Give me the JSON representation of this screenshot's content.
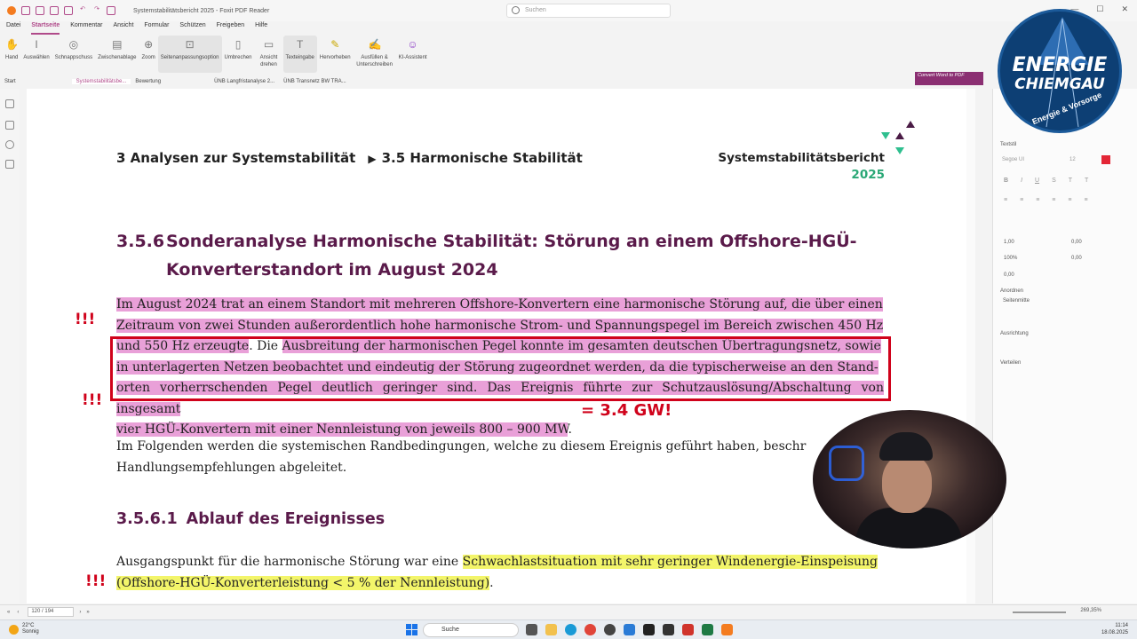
{
  "window": {
    "title": "Systemstabilitätsbericht 2025 - Foxit PDF Reader",
    "search_placeholder": "Suchen"
  },
  "menu": [
    "Datei",
    "Startseite",
    "Kommentar",
    "Ansicht",
    "Formular",
    "Schützen",
    "Freigeben",
    "Hilfe"
  ],
  "ribbon": [
    {
      "label": "Hand",
      "icon": "hand-icon"
    },
    {
      "label": "Auswählen",
      "icon": "select-icon"
    },
    {
      "label": "Schnappschuss",
      "icon": "snapshot-icon"
    },
    {
      "label": "Zwischenablage",
      "icon": "clipboard-icon"
    },
    {
      "label": "Zoom",
      "icon": "zoom-icon"
    },
    {
      "label": "Seitenanpassungsoption",
      "icon": "fit-page-icon"
    },
    {
      "label": "Umbrechen",
      "icon": "reflow-icon"
    },
    {
      "label": "Ansicht drehen",
      "icon": "rotate-icon"
    },
    {
      "label": "Texteingabe",
      "icon": "text-input-icon"
    },
    {
      "label": "Hervorheben",
      "icon": "highlight-icon"
    },
    {
      "label": "Ausfüllen & Unterschreiben",
      "icon": "sign-icon"
    },
    {
      "label": "KI-Assistent",
      "icon": "ai-icon"
    }
  ],
  "tabs": [
    "Start",
    "Systemstabilitätsbe...",
    "Bewertung",
    "ÜNB Langfristanalyse 2...",
    "ÜNB Transnetz BW TRA..."
  ],
  "convert_label": "Convert Word to PDF",
  "document": {
    "header_left_section": "3 Analysen zur Systemstabilität",
    "header_left_subsection": "3.5 Harmonische Stabilität",
    "header_right_title": "Systemstabilitätsbericht",
    "header_right_year": "2025",
    "heading_number": "3.5.6",
    "heading_text": "Sonderanalyse Harmonische Stabilität: Störung an einem Offshore-HGÜ-Konverterstandort im August 2024",
    "p1_line1": "Im August 2024 trat an einem Standort mit mehreren Offshore-Konvertern eine harmonische Störung auf, die über einen",
    "p1_line2": "Zeitraum von zwei Stunden außerordentlich hohe harmonische Strom- und Spannungspegel im Bereich zwischen 450 Hz",
    "p1_line3a": "und 550 Hz erzeugte",
    "p1_line3b": ". Die ",
    "p1_line3c": "Ausbreitung der harmonischen Pegel konnte im gesamten deutschen Übertragungsnetz, sowie",
    "p1_line4": "in unterlagerten Netzen beobachtet und eindeutig der Störung zugeordnet werden, da die typischerweise an den Stand-",
    "p1_line5": "orten vorherrschenden Pegel deutlich geringer sind. Das Ereignis führte zur Schutzauslösung/Abschaltung von insgesamt",
    "p1_line6": "vier HGÜ-Konvertern mit einer Nennleistung von jeweils 800 – 900 MW",
    "p1_line6_end": ".",
    "p2": "Im Folgenden werden die systemischen Randbedingungen, welche zu diesem Ereignis geführt haben, beschr",
    "p2_line2": "Handlungsempfehlungen abgeleitet.",
    "sub_number": "3.5.6.1",
    "sub_text": "Ablauf des Ereignisses",
    "p3_lead": "Ausgangspunkt für die harmonische Störung war eine ",
    "p3_hl1": "Schwachlastsituation mit sehr geringer Windenergie-Einspeisung",
    "p3_hl2": "(Offshore-HGÜ-Konverterleistung < 5 % der Nennleistung)",
    "p3_end": "."
  },
  "annotations": {
    "marker": "!!!",
    "gw_note": "= 3.4 GW!"
  },
  "right_panel": {
    "section_text": "Textstil",
    "font_name": "Segoe UI",
    "font_size": "12",
    "spacing1": "1,00",
    "spacing2": "0,00",
    "spacing3": "100%",
    "spacing4": "0,00",
    "spacing5": "0,00",
    "arrange": "Anordnen",
    "page_center": "Seitenmitte",
    "align": "Ausrichtung",
    "distribute": "Verteilen",
    "accent_color": "#e32636"
  },
  "logo": {
    "line1": "ENERGIE",
    "line2": "CHIEMGAU",
    "line3": "Energie & Vorsorge"
  },
  "statusbar": {
    "page": "120 / 194",
    "zoom": "269,35%"
  },
  "taskbar": {
    "temp": "22°C",
    "weather": "Sonnig",
    "search": "Suche",
    "time": "11:14",
    "date": "18.08.2025"
  }
}
